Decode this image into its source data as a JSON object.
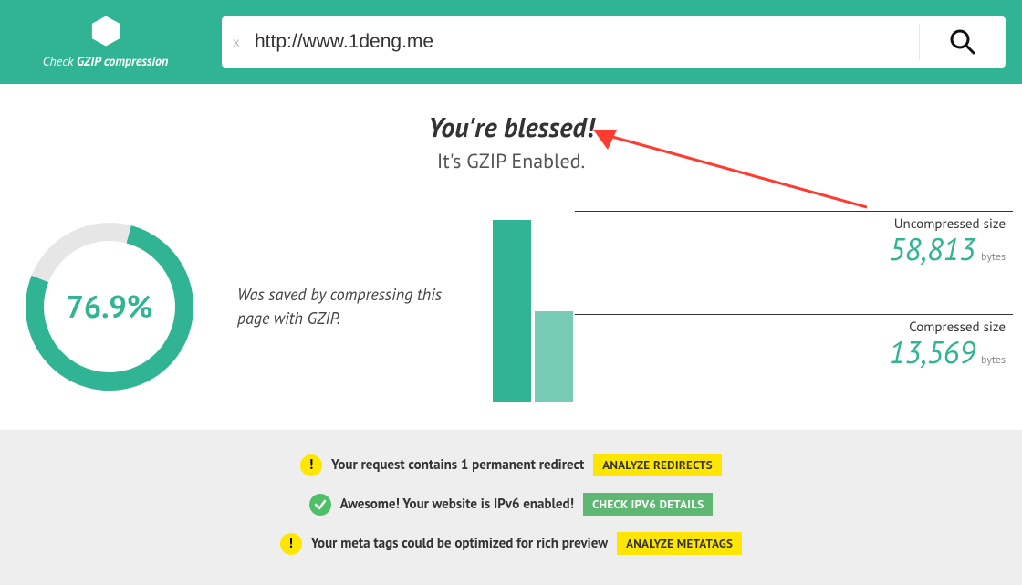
{
  "header": {
    "logo_prefix": "Check ",
    "logo_bold": "GZIP compression",
    "clear_symbol": "x",
    "url_value": "http://www.1deng.me"
  },
  "headline": {
    "title": "You're blessed!",
    "subtitle": "It's GZIP Enabled."
  },
  "savings": {
    "percent": "76.9%",
    "caption": "Was saved by compressing this page with GZIP."
  },
  "sizes": {
    "uncompressed": {
      "label": "Uncompressed size",
      "value": "58,813",
      "unit": "bytes"
    },
    "compressed": {
      "label": "Compressed size",
      "value": "13,569",
      "unit": "bytes"
    }
  },
  "notices": [
    {
      "status": "warn",
      "msg": "Your request contains 1 permanent redirect",
      "action": "ANALYZE REDIRECTS",
      "action_style": "yellow"
    },
    {
      "status": "ok",
      "msg": "Awesome! Your website is IPv6 enabled!",
      "action": "CHECK IPV6 DETAILS",
      "action_style": "green"
    },
    {
      "status": "warn",
      "msg": "Your meta tags could be optimized for rich preview",
      "action": "ANALYZE METATAGS",
      "action_style": "yellow"
    }
  ],
  "chart_data": {
    "type": "bar",
    "categories": [
      "Uncompressed",
      "Compressed"
    ],
    "values": [
      58813,
      13569
    ],
    "title": "",
    "xlabel": "",
    "ylabel": "bytes",
    "ylim": [
      0,
      60000
    ]
  }
}
